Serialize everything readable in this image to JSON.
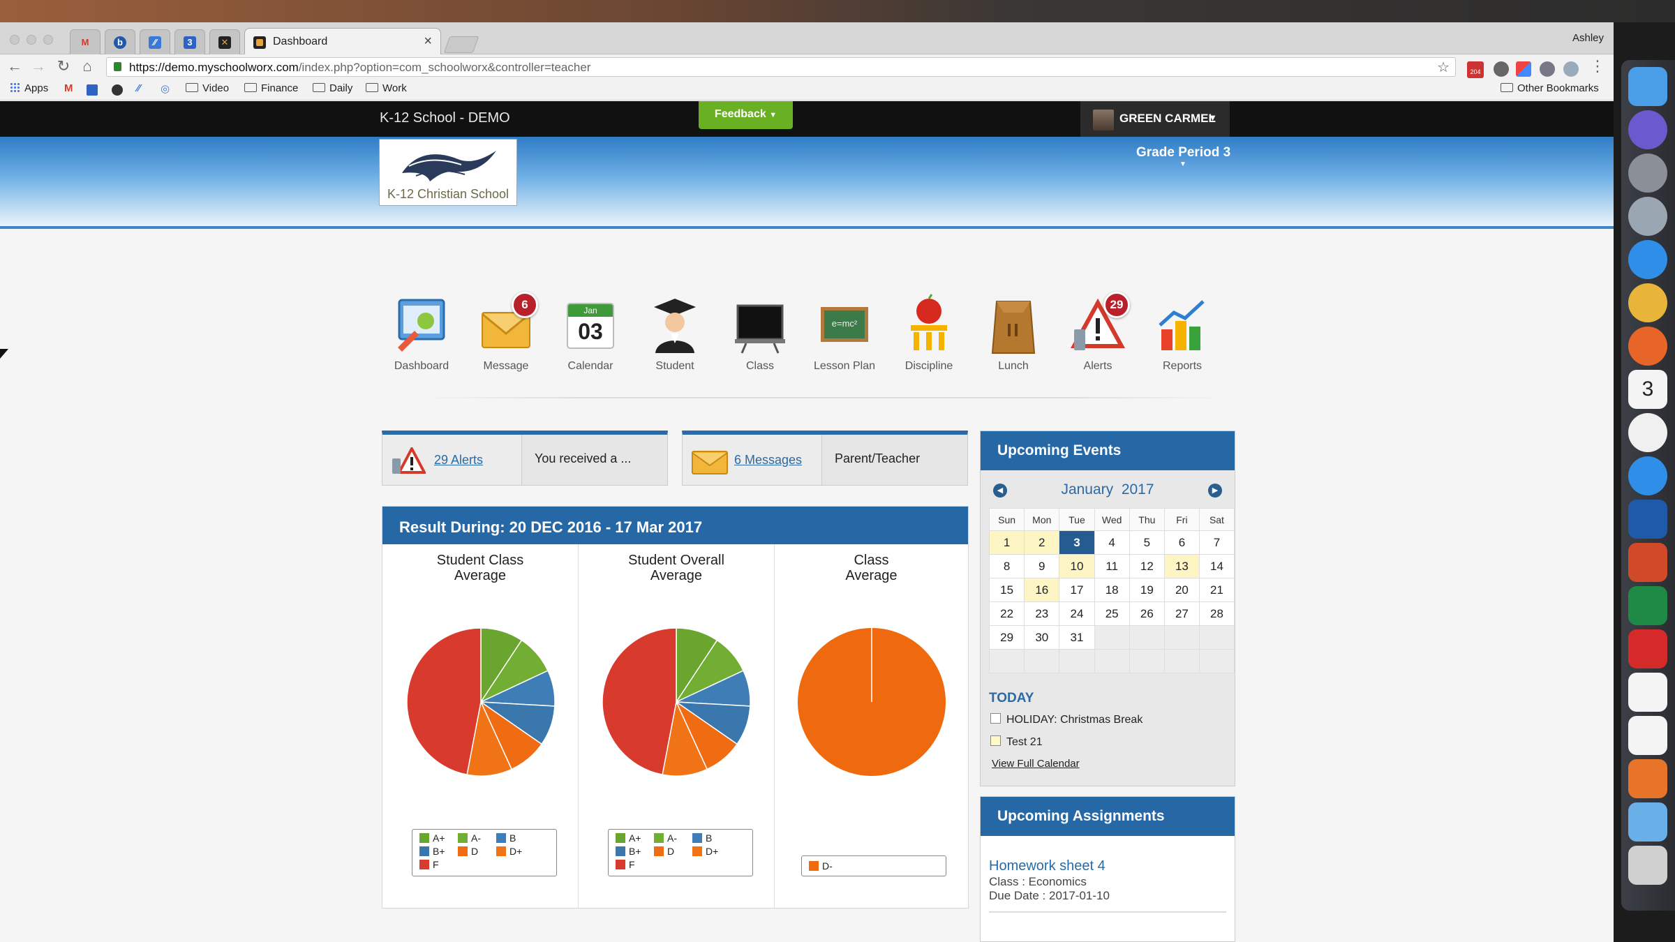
{
  "browser": {
    "tab_title": "Dashboard",
    "profile_name": "Ashley",
    "url_host": "https://demo.myschoolworx.com",
    "url_path": "/index.php?option=com_schoolworx&controller=teacher",
    "bookmarks": [
      "Apps",
      "Video",
      "Finance",
      "Daily",
      "Work"
    ],
    "other_bookmarks": "Other Bookmarks",
    "extension_badge": "204"
  },
  "topnav": {
    "school_name": "K-12 School - DEMO",
    "feedback_label": "Feedback",
    "user_name": "GREEN CARMEL"
  },
  "banner": {
    "logo_text": "K-12 Christian School",
    "grade_period": "Grade Period 3"
  },
  "nav_items": [
    {
      "label": "Dashboard",
      "icon": "dashboard-icon"
    },
    {
      "label": "Message",
      "icon": "envelope-icon",
      "badge": "6"
    },
    {
      "label": "Calendar",
      "icon": "calendar-icon",
      "month": "Jan",
      "day": "03"
    },
    {
      "label": "Student",
      "icon": "graduate-icon"
    },
    {
      "label": "Class",
      "icon": "chalkboard-icon"
    },
    {
      "label": "Lesson Plan",
      "icon": "blackboard-icon",
      "board_text": "e=mc²"
    },
    {
      "label": "Discipline",
      "icon": "apple-icon"
    },
    {
      "label": "Lunch",
      "icon": "lunch-bag-icon"
    },
    {
      "label": "Alerts",
      "icon": "alert-icon",
      "badge": "29"
    },
    {
      "label": "Reports",
      "icon": "bar-chart-icon"
    }
  ],
  "alerts_box": {
    "link": "29 Alerts",
    "message": "You received a ..."
  },
  "messages_box": {
    "link": "6 Messages",
    "message": "Parent/Teacher"
  },
  "results": {
    "title": "Result During: 20 DEC 2016 - 17 Mar 2017",
    "chart_titles": [
      [
        "Student Class",
        "Average"
      ],
      [
        "Student Overall",
        "Average"
      ],
      [
        "Class",
        "Average"
      ]
    ]
  },
  "chart_data": [
    {
      "type": "pie",
      "title": "Student Class Average",
      "labels": [
        "A+",
        "A-",
        "B",
        "B+",
        "D",
        "D+",
        "F"
      ],
      "values": [
        8.5,
        8.0,
        7.2,
        8.0,
        7.8,
        9.0,
        43.0
      ],
      "legend": [
        "A+",
        "A-",
        "B",
        "B+",
        "D",
        "D+",
        "F"
      ],
      "legend_placement": "bottom"
    },
    {
      "type": "pie",
      "title": "Student Overall Average",
      "labels": [
        "A+",
        "A-",
        "B",
        "B+",
        "D",
        "D+",
        "F"
      ],
      "values": [
        8.5,
        8.0,
        7.2,
        8.0,
        7.8,
        9.0,
        43.0
      ],
      "legend": [
        "A+",
        "A-",
        "B",
        "B+",
        "D",
        "D+",
        "F"
      ],
      "legend_placement": "bottom"
    },
    {
      "type": "pie",
      "title": "Class Average",
      "labels": [
        "D-"
      ],
      "values": [
        100
      ],
      "legend": [
        "D-"
      ],
      "legend_placement": "bottom"
    }
  ],
  "colors": {
    "A+": "#6aa52f",
    "A-": "#72ae34",
    "B": "#3e7db5",
    "B+": "#3a77ad",
    "D": "#ef6c12",
    "D+": "#f07315",
    "F": "#d93a2e",
    "D-": "#ef6a0e",
    "header_blue": "#2668a6",
    "feedback_green": "#6ab023"
  },
  "events": {
    "title": "Upcoming Events",
    "month": "January",
    "year": "2017",
    "weekdays": [
      "Sun",
      "Mon",
      "Tue",
      "Wed",
      "Thu",
      "Fri",
      "Sat"
    ],
    "weeks": [
      [
        "1",
        "2",
        "3",
        "4",
        "5",
        "6",
        "7"
      ],
      [
        "8",
        "9",
        "10",
        "11",
        "12",
        "13",
        "14"
      ],
      [
        "15",
        "16",
        "17",
        "18",
        "19",
        "20",
        "21"
      ],
      [
        "22",
        "23",
        "24",
        "25",
        "26",
        "27",
        "28"
      ],
      [
        "29",
        "30",
        "31",
        "",
        "",
        "",
        ""
      ],
      [
        "",
        "",
        "",
        "",
        "",
        "",
        ""
      ]
    ],
    "highlighted_days": [
      "1",
      "2",
      "10",
      "13",
      "16"
    ],
    "today_day": "3",
    "today_label": "TODAY",
    "today_events": [
      "HOLIDAY: Christmas Break",
      "Test 21"
    ],
    "view_full": "View Full Calendar"
  },
  "assignments": {
    "title": "Upcoming Assignments",
    "item_title": "Homework sheet 4",
    "class_line": "Class : Economics",
    "due_line": "Due Date : 2017-01-10"
  },
  "dock_icons": [
    "finder-icon",
    "siri-icon",
    "system-preferences-icon",
    "launchpad-icon",
    "safari-icon",
    "chrome-icon",
    "firefox-icon",
    "calendar-app-icon",
    "itunes-icon",
    "app-store-icon",
    "word-icon",
    "powerpoint-icon",
    "excel-icon",
    "red-cubes-icon",
    "slack-icon",
    "notes-icon",
    "gear-flower-icon",
    "folder-icon",
    "trash-icon"
  ],
  "dock_calendar_day": "3"
}
